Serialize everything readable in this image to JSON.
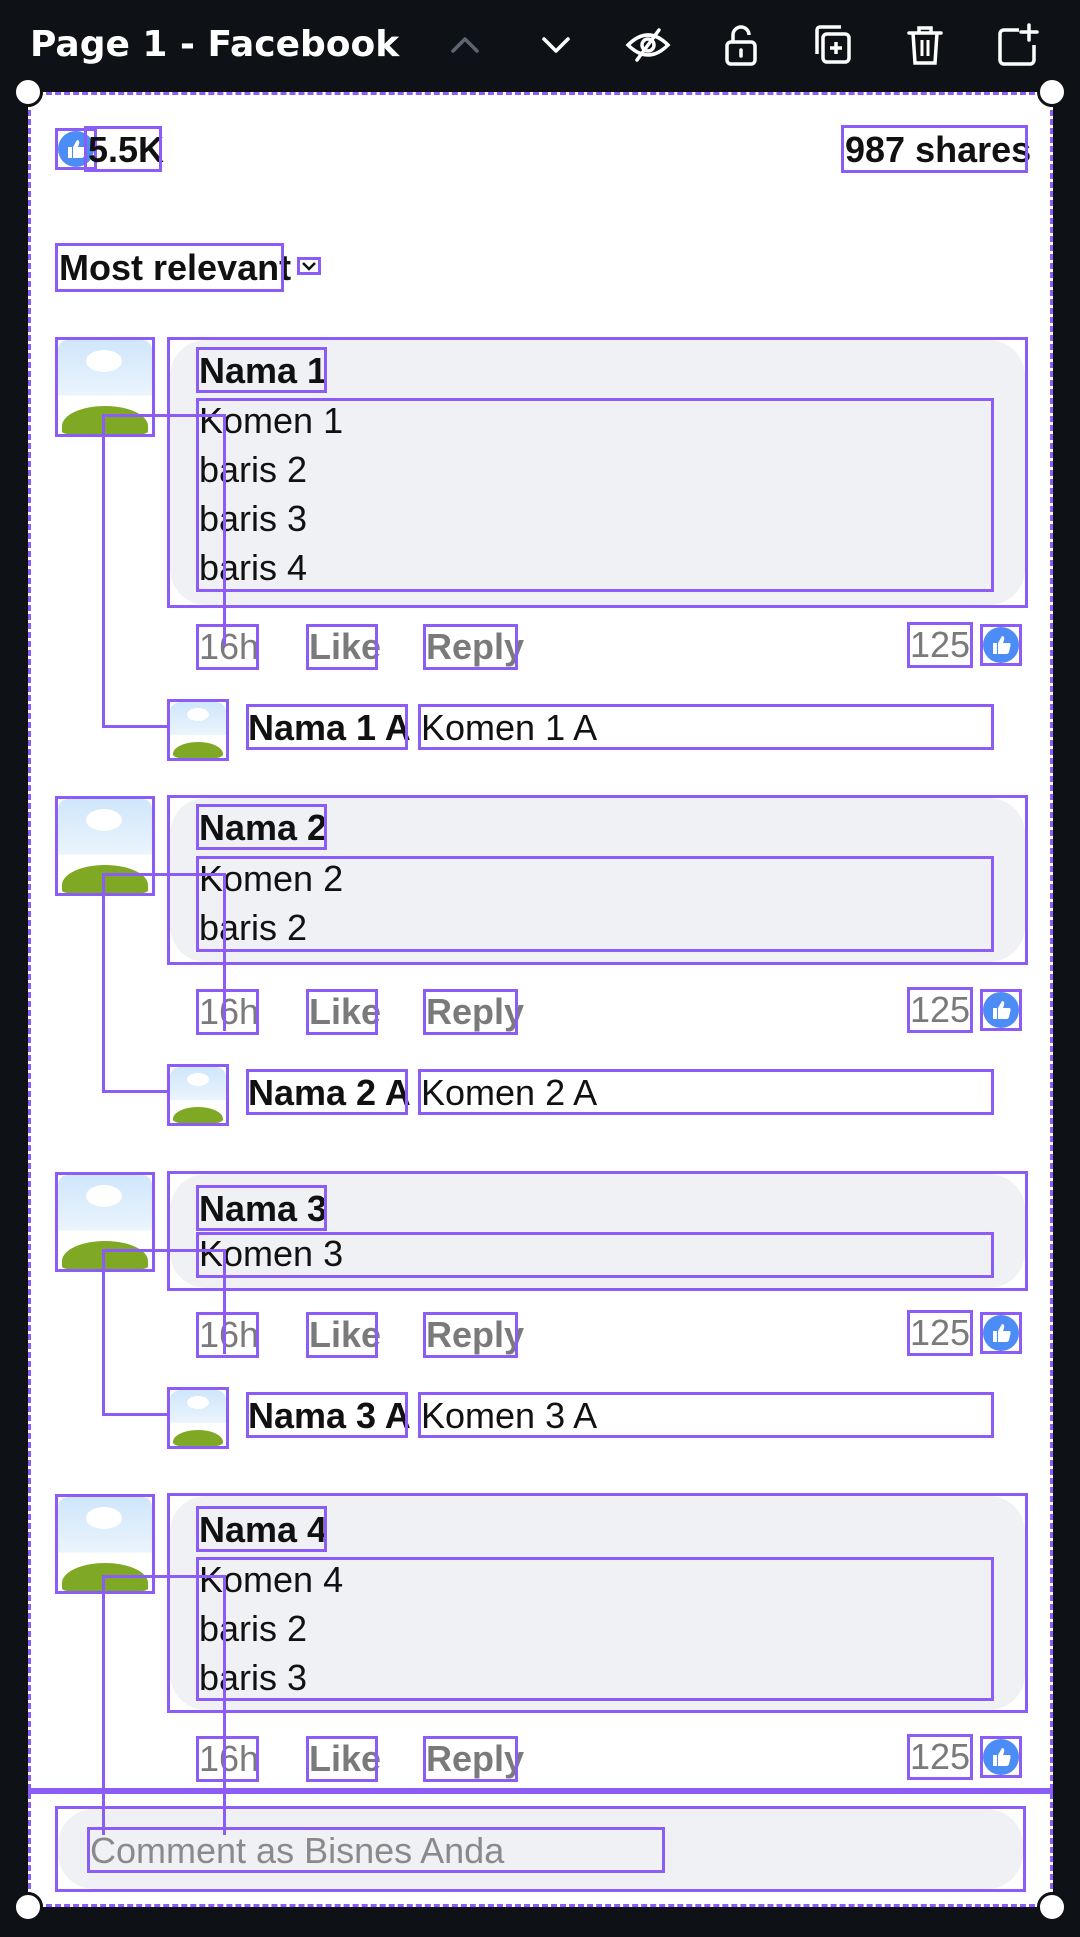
{
  "page_title": "Page 1 - Facebook",
  "reactions": {
    "likes_count": "5.5K",
    "shares": "987 shares"
  },
  "sort": {
    "label": "Most relevant"
  },
  "comments": [
    {
      "name": "Nama 1",
      "lines": [
        "Komen 1",
        "baris 2",
        "baris 3",
        "baris 4"
      ],
      "time": "16h",
      "like": "Like",
      "reply": "Reply",
      "likes": "125",
      "reply_item": {
        "name": "Nama 1 A",
        "text": "Komen 1 A"
      }
    },
    {
      "name": "Nama 2",
      "lines": [
        "Komen 2",
        "baris 2"
      ],
      "time": "16h",
      "like": "Like",
      "reply": "Reply",
      "likes": "125",
      "reply_item": {
        "name": "Nama 2 A",
        "text": "Komen 2 A"
      }
    },
    {
      "name": "Nama 3",
      "lines": [
        "Komen 3"
      ],
      "time": "16h",
      "like": "Like",
      "reply": "Reply",
      "likes": "125",
      "reply_item": {
        "name": "Nama 3 A",
        "text": "Komen 3 A"
      }
    },
    {
      "name": "Nama 4",
      "lines": [
        "Komen 4",
        "baris 2",
        "baris 3"
      ],
      "time": "16h",
      "like": "Like",
      "reply": "Reply",
      "likes": "125"
    }
  ],
  "composer": {
    "placeholder": "Comment as Bisnes Anda"
  },
  "toolbar_icons": [
    "chevron-up-icon",
    "chevron-down-icon",
    "hide-icon",
    "unlock-icon",
    "duplicate-icon",
    "trash-icon",
    "share-icon"
  ],
  "colors": {
    "selection": "#8b5cf6",
    "like_blue": "#4b8cf5",
    "bubble_bg": "#f0f1f5",
    "topbar_bg": "#0e1116"
  }
}
